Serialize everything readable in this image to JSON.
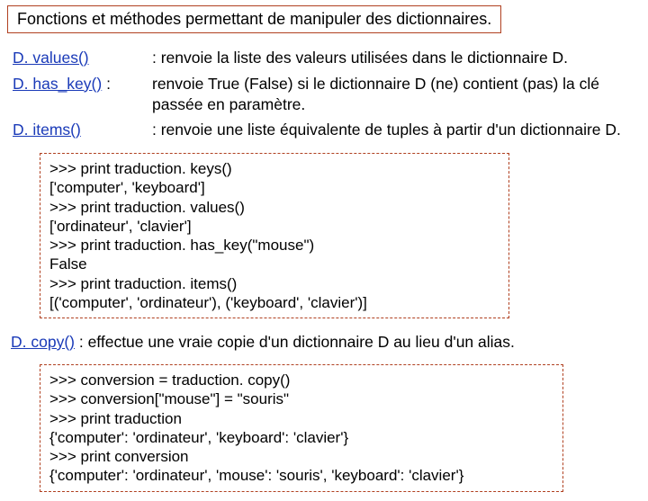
{
  "title": "Fonctions et méthodes permettant de manipuler des dictionnaires.",
  "methods": {
    "values": {
      "name": "D. values()",
      "desc_prefix": ": renvoie la liste des valeurs utilisées dans le dictionnaire D."
    },
    "has_key": {
      "name": "D. has_key()",
      "sep": " :",
      "desc": "renvoie True (False) si le dictionnaire D (ne) contient (pas) la clé passée en paramètre."
    },
    "items": {
      "name": "D. items()",
      "desc": ": renvoie une liste équivalente de tuples à partir d'un dictionnaire D."
    },
    "copy": {
      "name": "D. copy()",
      "desc": " : effectue une vraie copie d'un dictionnaire D au lieu d'un alias."
    }
  },
  "code1": {
    "l1": ">>> print traduction. keys()",
    "l2": "['computer', 'keyboard']",
    "l3": ">>> print traduction. values()",
    "l4": "['ordinateur', 'clavier']",
    "l5": ">>> print traduction. has_key(\"mouse\")",
    "l6": "False",
    "l7": ">>> print traduction. items()",
    "l8": "[('computer', 'ordinateur'), ('keyboard', 'clavier')]"
  },
  "code2": {
    "l1": ">>> conversion = traduction. copy()",
    "l2": ">>> conversion[\"mouse\"] = \"souris\"",
    "l3": ">>> print traduction",
    "l4": "{'computer': 'ordinateur', 'keyboard': 'clavier'}",
    "l5": ">>> print conversion",
    "l6": "{'computer': 'ordinateur', 'mouse': 'souris', 'keyboard': 'clavier'}"
  }
}
